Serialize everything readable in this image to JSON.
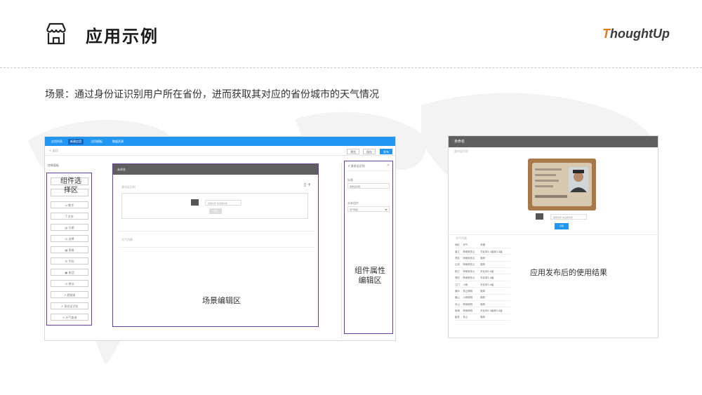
{
  "header": {
    "title": "应用示例",
    "brand_first": "T",
    "brand_rest": "houghtUp"
  },
  "scene": "场景：通过身份证识别用户所在省份，进而获取其对应的省份城市的天气情况",
  "editor": {
    "tabs": [
      "应用列表",
      "新建应用",
      "应用模板",
      "数据资源"
    ],
    "back": "< 返回",
    "buttons": {
      "preview": "预览",
      "save": "保存",
      "publish": "发布"
    },
    "left_title": "控制面板",
    "components_caption_1": "组件选",
    "components_caption_2": "择区",
    "components": [
      "⇔ 数字",
      "T 文本",
      "▤ 日期",
      "☑ 选择",
      "▦ 表格",
      "✆ 手机",
      "▣ 电话",
      "◷ 地址",
      "⇗ 超链接",
      "⇗ 身份证识别",
      "⇗ 天气查询"
    ],
    "canvas_title": "未命名",
    "idcard_label": "身份证识别",
    "tools": "▯ +",
    "upload_placeholder": "选择文件 未选择文件",
    "upload_button": "识别",
    "weather_label": "天气列表",
    "canvas_caption": "场景编辑区",
    "prop_title": "⇗ 身份证识别",
    "prop_close": "✕",
    "prop_label_1": "标题",
    "prop_value_1": "身份证识别",
    "prop_label_2": "关联组件",
    "prop_value_2": "天气列表",
    "prop_caption_1": "组件属性",
    "prop_caption_2": "编辑区"
  },
  "result": {
    "title": "未命名",
    "subtitle": "身份证识别",
    "upload_placeholder": "选择文件 未选择文件",
    "upload_button": "识别",
    "weather_label": "天气列表",
    "table_header": [
      "地区",
      "天气",
      "风速"
    ],
    "table_rows": [
      [
        "湛江",
        "阵雨转多云",
        "东北风4-5级转3-4级"
      ],
      [
        "茂名",
        "阵雨转多云",
        "微风"
      ],
      [
        "云浮",
        "阵雨转多云",
        "微风"
      ],
      [
        "阳江",
        "阵雨转多云",
        "东北风4-5级"
      ],
      [
        "肇庆",
        "阵雨转多云",
        "东北风3-4级"
      ],
      [
        "江门",
        "小雨",
        "东北风3-4级"
      ],
      [
        "潮州",
        "多云转阴",
        "微风"
      ],
      [
        "佛山",
        "小雨转阴",
        "微风"
      ],
      [
        "中山",
        "阵雨转阴",
        "微风"
      ],
      [
        "珠海",
        "阵雨转阴",
        "东北风4-5级转3-4级"
      ],
      [
        "韶关",
        "多云",
        "微风"
      ]
    ],
    "caption": "应用发布后的使用结果"
  }
}
